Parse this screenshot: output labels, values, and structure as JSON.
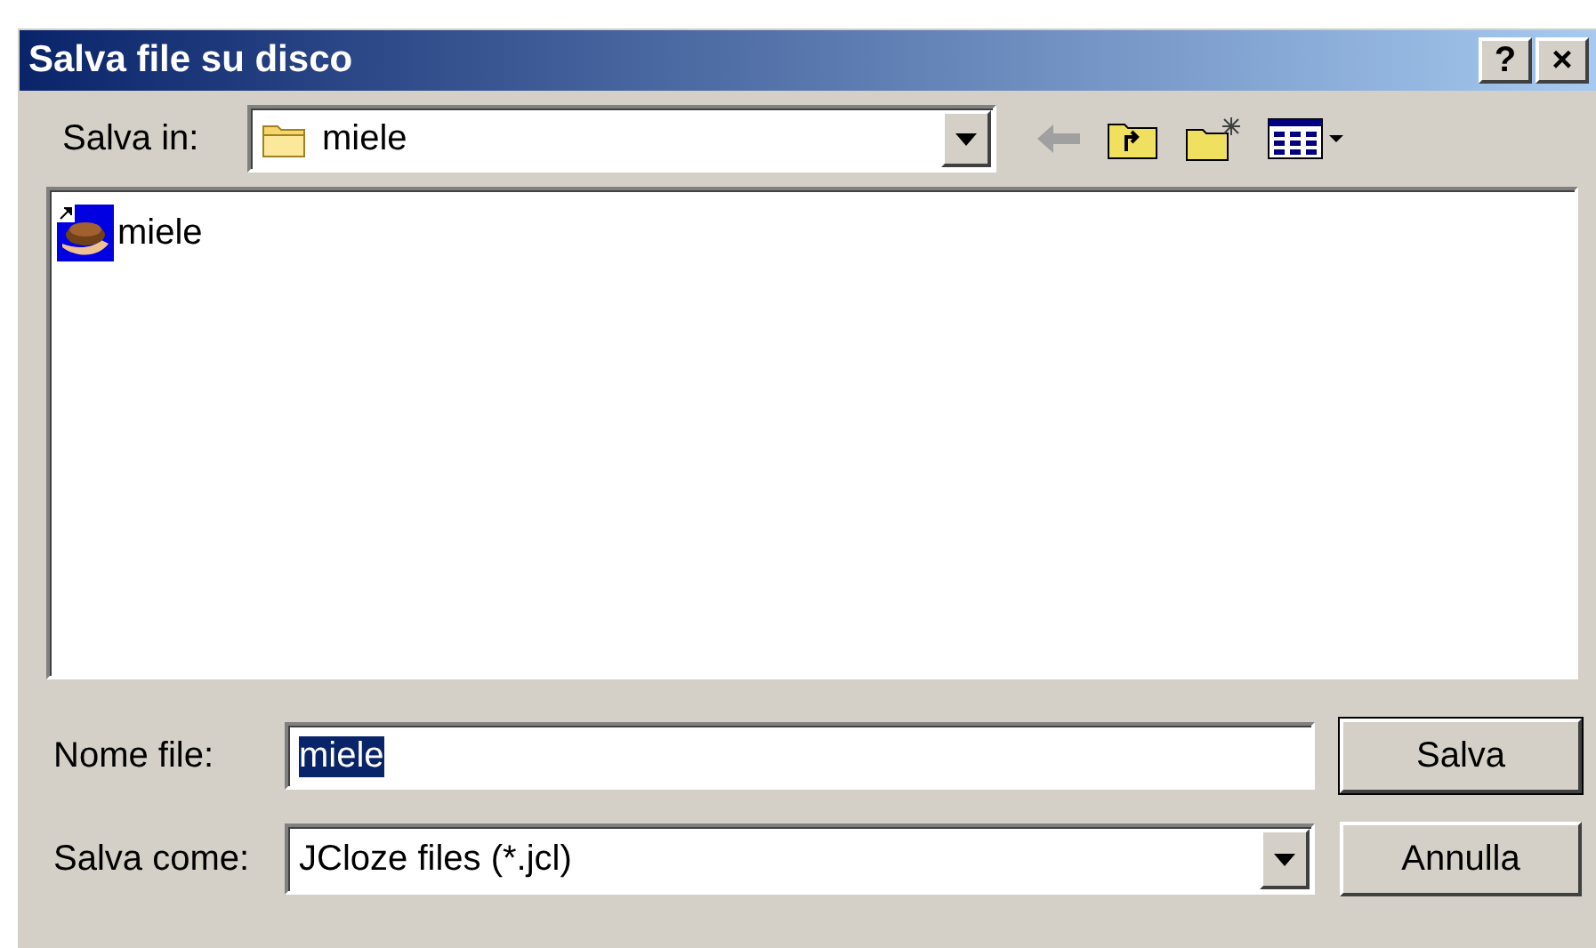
{
  "window": {
    "title": "Salva file su disco",
    "help_button": "?",
    "close_button": "×"
  },
  "save_in": {
    "label": "Salva in:",
    "value": "miele"
  },
  "files": [
    {
      "name": "miele",
      "kind": "shortcut"
    }
  ],
  "file_name": {
    "label": "Nome file:",
    "value": "miele",
    "selected": true
  },
  "save_as": {
    "label": "Salva come:",
    "value": "JCloze files (*.jcl)"
  },
  "buttons": [
    {
      "label": "Salva",
      "default": true
    },
    {
      "label": "Annulla",
      "default": false
    }
  ]
}
